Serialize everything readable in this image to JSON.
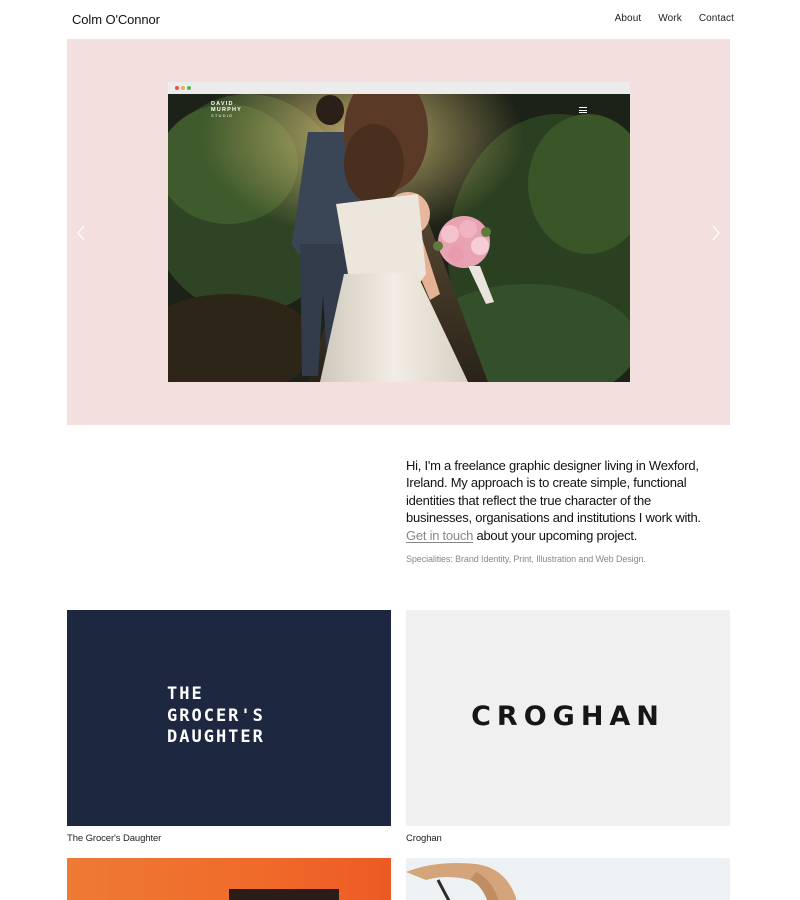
{
  "header": {
    "site_title": "Colm O'Connor",
    "nav": [
      "About",
      "Work",
      "Contact"
    ]
  },
  "hero": {
    "background": "#f4dfdf",
    "browser_brand": [
      "DAVID",
      "MURPHY",
      "STUDIO"
    ],
    "prev_icon": "chevron-left-icon",
    "next_icon": "chevron-right-icon"
  },
  "intro": {
    "text_part1": "Hi, I'm a freelance graphic designer living in Wexford, Ireland. My approach is to create simple, functional identities that reflect the true character of the businesses, organisations and institutions I work with.",
    "link": "Get in touch",
    "text_part2": " about your upcoming project.",
    "specialities": "Specialities: Brand Identity, Print, Illustration and Web Design."
  },
  "projects": [
    {
      "logo_lines": [
        "THE",
        "GROCER'S",
        "DAUGHTER"
      ],
      "caption": "The Grocer's Daughter",
      "color": "#1d2840"
    },
    {
      "logo": "CROGHAN",
      "caption": "Croghan",
      "color": "#f0f0f0"
    },
    {
      "caption": "",
      "color": "#ee7a35"
    },
    {
      "caption": "",
      "color": "#eef1f4"
    }
  ]
}
